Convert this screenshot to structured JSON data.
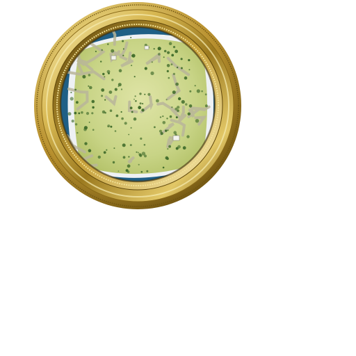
{
  "minimap": {
    "frame_style": "ornate-gold-beaded-ring",
    "terrain": "grassland-with-trees-and-rocky-ridges",
    "colors": {
      "frame_light": "#f2e39a",
      "frame_mid": "#c9a640",
      "frame_dark": "#6d5310",
      "grass": "#c8d486",
      "grass_light": "#dfe4a6",
      "trees": "#3f6b2a",
      "ridges": "#b9b69a",
      "water": "#1f5f86",
      "shore": "#eef1f4"
    }
  }
}
